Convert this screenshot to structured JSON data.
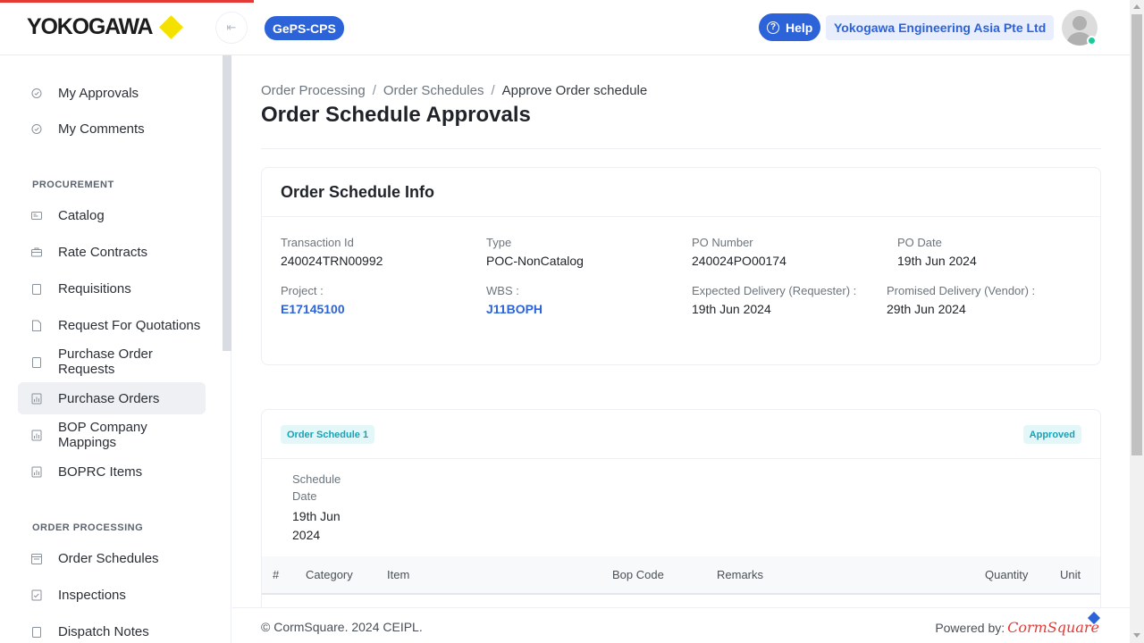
{
  "header": {
    "logo_text": "YOKOGAWA",
    "app_badge": "GePS-CPS",
    "help_label": "Help",
    "company": "Yokogawa Engineering Asia Pte Ltd"
  },
  "sidebar": {
    "top_items": [
      {
        "label": "My Approvals",
        "icon": "check-circle-icon"
      },
      {
        "label": "My Comments",
        "icon": "check-circle-icon"
      }
    ],
    "procurement_title": "PROCUREMENT",
    "procurement_items": [
      {
        "label": "Catalog",
        "icon": "list-card-icon"
      },
      {
        "label": "Rate Contracts",
        "icon": "briefcase-icon"
      },
      {
        "label": "Requisitions",
        "icon": "clipboard-icon"
      },
      {
        "label": "Request For Quotations",
        "icon": "document-icon"
      },
      {
        "label": "Purchase Order Requests",
        "icon": "clipboard-icon"
      },
      {
        "label": "Purchase Orders",
        "icon": "chart-doc-icon"
      },
      {
        "label": "BOP Company Mappings",
        "icon": "chart-doc-icon"
      },
      {
        "label": "BOPRC Items",
        "icon": "chart-doc-icon"
      }
    ],
    "order_processing_title": "ORDER PROCESSING",
    "order_processing_items": [
      {
        "label": "Order Schedules",
        "icon": "calendar-icon"
      },
      {
        "label": "Inspections",
        "icon": "checklist-icon"
      },
      {
        "label": "Dispatch Notes",
        "icon": "clipboard-icon"
      }
    ],
    "active_item": "Purchase Orders"
  },
  "breadcrumb": [
    "Order Processing",
    "Order Schedules",
    "Approve Order schedule"
  ],
  "page_title": "Order Schedule Approvals",
  "info_card": {
    "title": "Order Schedule Info",
    "transaction_id_label": "Transaction Id",
    "transaction_id": "240024TRN00992",
    "type_label": "Type",
    "type": "POC-NonCatalog",
    "po_number_label": "PO Number",
    "po_number": "240024PO00174",
    "po_date_label": "PO Date",
    "po_date": "19th Jun 2024",
    "project_label": "Project :",
    "project": "E17145100",
    "wbs_label": "WBS :",
    "wbs": "J11BOPH",
    "expected_delivery_label": "Expected Delivery (Requester) :",
    "expected_delivery": "19th Jun 2024",
    "promised_delivery_label": "Promised Delivery (Vendor) :",
    "promised_delivery": "29th Jun 2024"
  },
  "schedule": {
    "label": "Order Schedule 1",
    "status": "Approved",
    "date_label": "Schedule Date",
    "date": "19th Jun 2024",
    "columns": [
      "#",
      "Category",
      "Item",
      "Bop Code",
      "Remarks",
      "Quantity",
      "Unit"
    ]
  },
  "footer": {
    "copyright": "© CormSquare. 2024 CEIPL.",
    "powered_by": "Powered by:",
    "brand": "CormSquare"
  }
}
